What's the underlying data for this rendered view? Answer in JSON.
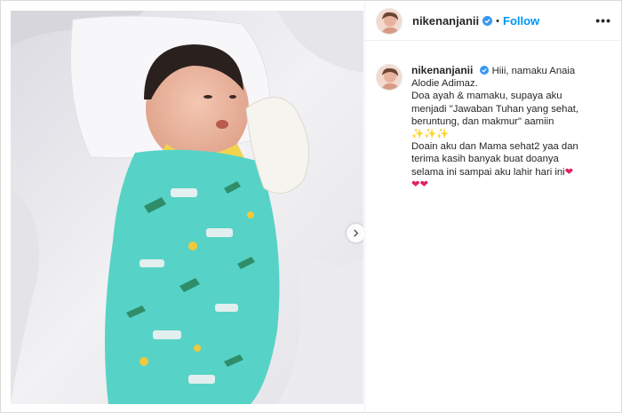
{
  "post": {
    "username": "nikenanjanii",
    "verified": true,
    "follow_separator": "•",
    "follow_label": "Follow",
    "more_label": "•••"
  },
  "caption": {
    "username": "nikenanjanii",
    "line1": "Hiii, namaku Anaia",
    "line2": "Alodie Adimaz.",
    "line3": "Doa ayah & mamaku, supaya aku",
    "line4": "menjadi \"Jawaban Tuhan yang sehat,",
    "line5": "beruntung, dan makmur\" aamiin",
    "sparkles": "✨✨✨",
    "line6": "Doain aku dan Mama sehat2 yaa dan",
    "line7": "terima kasih banyak buat doanya",
    "line8": "selama ini sampai aku lahir hari ini",
    "hearts_inline": "❤",
    "hearts_after": "❤❤"
  },
  "colors": {
    "follow": "#0095f6",
    "verified": "#3897f0",
    "heart": "#e0245e",
    "swaddle": "#56d3c6"
  },
  "icons": {
    "verified": "verified-badge-icon",
    "next": "chevron-right-icon",
    "more": "more-options-icon"
  }
}
